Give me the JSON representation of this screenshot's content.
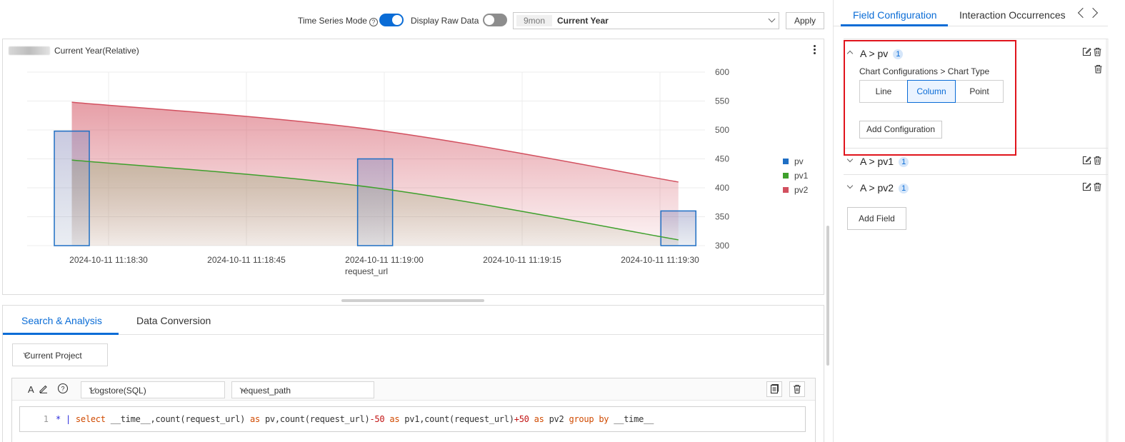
{
  "toolbar": {
    "time_series_label": "Time Series Mode",
    "time_series_on": true,
    "raw_data_label": "Display Raw Data",
    "raw_data_on": false,
    "time_tag": "9mon",
    "time_value": "Current Year",
    "apply_label": "Apply"
  },
  "chart": {
    "title": "Current Year(Relative)"
  },
  "chart_data": {
    "type": "line",
    "title": "Current Year(Relative)",
    "xlabel": "request_url",
    "ylabel": "",
    "x_ticks": [
      "2024-10-11 11:18:30",
      "2024-10-11 11:18:45",
      "2024-10-11 11:19:00",
      "2024-10-11 11:19:15",
      "2024-10-11 11:19:30"
    ],
    "y_ticks": [
      300,
      350,
      400,
      450,
      500,
      550,
      600
    ],
    "ylim": [
      300,
      600
    ],
    "y_axis_position": "right",
    "legend_position": "right",
    "series": [
      {
        "name": "pv",
        "type": "column",
        "color": "#1f6fc4",
        "points": [
          [
            "2024-10-11 11:18:26",
            498
          ],
          [
            "2024-10-11 11:18:59",
            450
          ],
          [
            "2024-10-11 11:19:32",
            360
          ]
        ]
      },
      {
        "name": "pv1",
        "type": "line",
        "color": "#3ea02c",
        "points": [
          [
            "2024-10-11 11:18:26",
            448
          ],
          [
            "2024-10-11 11:18:59",
            400
          ],
          [
            "2024-10-11 11:19:32",
            310
          ]
        ]
      },
      {
        "name": "pv2",
        "type": "area",
        "color": "#d2505f",
        "points": [
          [
            "2024-10-11 11:18:26",
            548
          ],
          [
            "2024-10-11 11:18:59",
            500
          ],
          [
            "2024-10-11 11:19:32",
            410
          ]
        ]
      }
    ]
  },
  "editor": {
    "tabs": [
      "Search & Analysis",
      "Data Conversion"
    ],
    "project_label": "Current Project",
    "store_type": "Logstore(SQL)",
    "logstore": "request_path",
    "line_number": "1",
    "query": {
      "p1": "* ",
      "p2": "| ",
      "p3": "select",
      "p4": " __time__,count(request_url) ",
      "p5": "as",
      "p6": " pv,count(request_url)",
      "p7": "-50",
      "p8": " ",
      "p9": "as",
      "p10": " pv1,count(request_url)",
      "p11": "+50",
      "p12": " ",
      "p13": "as",
      "p14": " pv2 ",
      "p15": "group by",
      "p16": " __time__"
    }
  },
  "right": {
    "tabs": [
      "Field Configuration",
      "Interaction Occurrences"
    ],
    "fields": [
      {
        "name": "A > pv",
        "count": "1"
      },
      {
        "name": "A > pv1",
        "count": "1"
      },
      {
        "name": "A > pv2",
        "count": "1"
      }
    ],
    "config_path": "Chart Configurations > Chart Type",
    "chart_types": [
      "Line",
      "Column",
      "Point"
    ],
    "selected_chart_type": "Column",
    "add_config_label": "Add Configuration",
    "add_field_label": "Add Field"
  }
}
